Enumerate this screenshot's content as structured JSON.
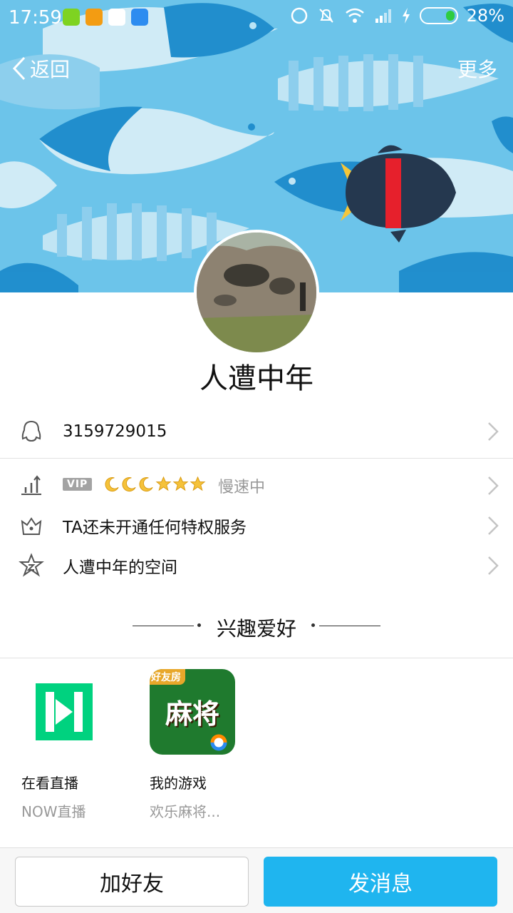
{
  "status_bar": {
    "time": "17:59",
    "battery_percent": "28%",
    "battery_level": 0.28,
    "app_icon_colors": [
      "#7ed321",
      "#f39c12",
      "#2ecc71",
      "#2d8cf0"
    ]
  },
  "nav": {
    "back_label": "返回",
    "more_label": "更多"
  },
  "profile": {
    "nickname": "人遭中年",
    "qq_number": "3159729015",
    "vip_badge": "VIP",
    "level_icons": [
      "moon",
      "moon",
      "moon",
      "star",
      "star",
      "star"
    ],
    "speed_status": "慢速中",
    "privilege_text": "TA还未开通任何特权服务",
    "space_text": "人遭中年的空间"
  },
  "interests": {
    "section_title": "兴趣爱好",
    "items": [
      {
        "title": "在看直播",
        "subtitle": "NOW直播",
        "icon": "now-live-icon"
      },
      {
        "title": "我的游戏",
        "subtitle": "欢乐麻将...",
        "icon": "mahjong-game-icon",
        "icon_text": "麻将",
        "icon_banner": "好友房"
      }
    ]
  },
  "actions": {
    "add_friend": "加好友",
    "send_message": "发消息"
  },
  "colors": {
    "accent": "#1fb5ef",
    "cover_bg": "#6cc4ea",
    "now_green": "#00d27f"
  }
}
